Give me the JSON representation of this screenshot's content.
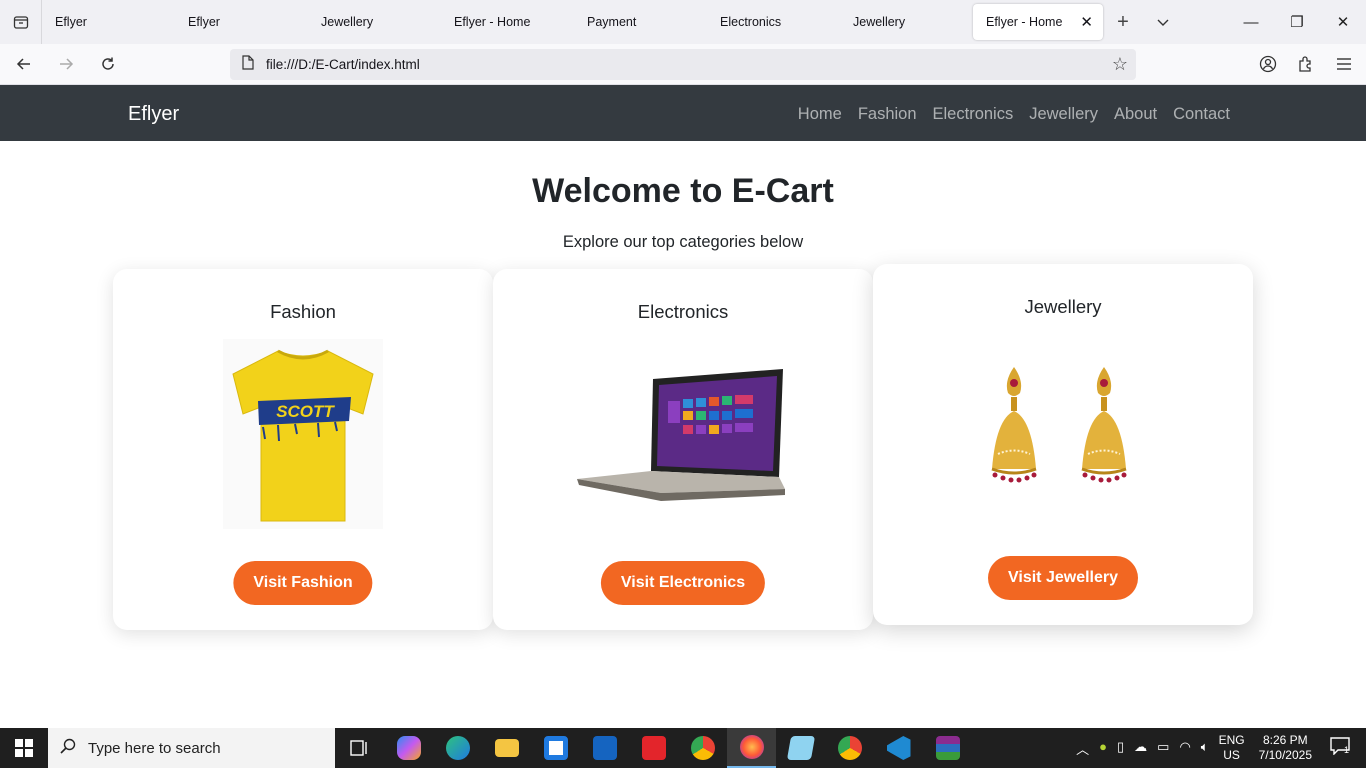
{
  "browser": {
    "tabs": [
      {
        "label": "Eflyer"
      },
      {
        "label": "Eflyer"
      },
      {
        "label": "Jewellery"
      },
      {
        "label": "Eflyer - Home"
      },
      {
        "label": "Payment"
      },
      {
        "label": "Electronics"
      },
      {
        "label": "Jewellery"
      },
      {
        "label": "Eflyer - Home",
        "active": true
      }
    ],
    "url": "file:///D:/E-Cart/index.html"
  },
  "site": {
    "brand": "Eflyer",
    "nav": [
      "Home",
      "Fashion",
      "Electronics",
      "Jewellery",
      "About",
      "Contact"
    ],
    "title": "Welcome to E-Cart",
    "subtitle": "Explore our top categories below",
    "cards": [
      {
        "title": "Fashion",
        "button": "Visit Fashion",
        "image_text": "SCOTT"
      },
      {
        "title": "Electronics",
        "button": "Visit Electronics"
      },
      {
        "title": "Jewellery",
        "button": "Visit Jewellery"
      }
    ]
  },
  "taskbar": {
    "search_placeholder": "Type here to search",
    "lang_line1": "ENG",
    "lang_line2": "US",
    "time": "8:26 PM",
    "date": "7/10/2025",
    "notification_count": "1"
  },
  "colors": {
    "header_bg": "#343a40",
    "accent": "#f26722",
    "taskbar_bg": "#1f1f1f"
  }
}
